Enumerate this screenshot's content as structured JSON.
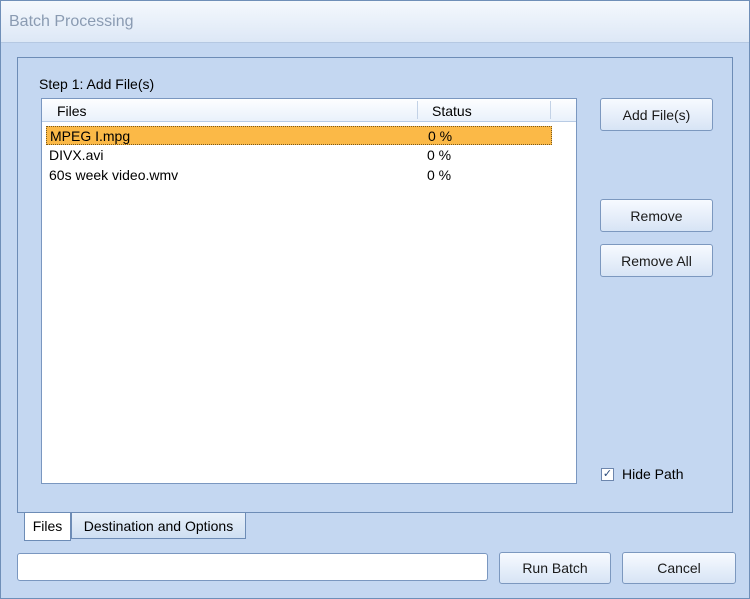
{
  "window": {
    "title": "Batch Processing"
  },
  "step": {
    "label": "Step 1: Add File(s)"
  },
  "list": {
    "columns": [
      "Files",
      "Status"
    ],
    "rows": [
      {
        "file": "MPEG I.mpg",
        "status": "0 %",
        "selected": true
      },
      {
        "file": "DIVX.avi",
        "status": "0 %",
        "selected": false
      },
      {
        "file": "60s week video.wmv",
        "status": "0 %",
        "selected": false
      }
    ]
  },
  "buttons": {
    "add_files": "Add File(s)",
    "remove": "Remove",
    "remove_all": "Remove All",
    "run_batch": "Run Batch",
    "cancel": "Cancel"
  },
  "options": {
    "hide_path_label": "Hide Path",
    "hide_path_checked": true,
    "check_glyph": "✓"
  },
  "tabs": [
    {
      "label": "Files",
      "active": true
    },
    {
      "label": "Destination and Options",
      "active": false
    }
  ],
  "progress": {
    "value": 0
  },
  "colors": {
    "selected_row": "#fbb947",
    "window_bg": "#c4d7f1"
  }
}
